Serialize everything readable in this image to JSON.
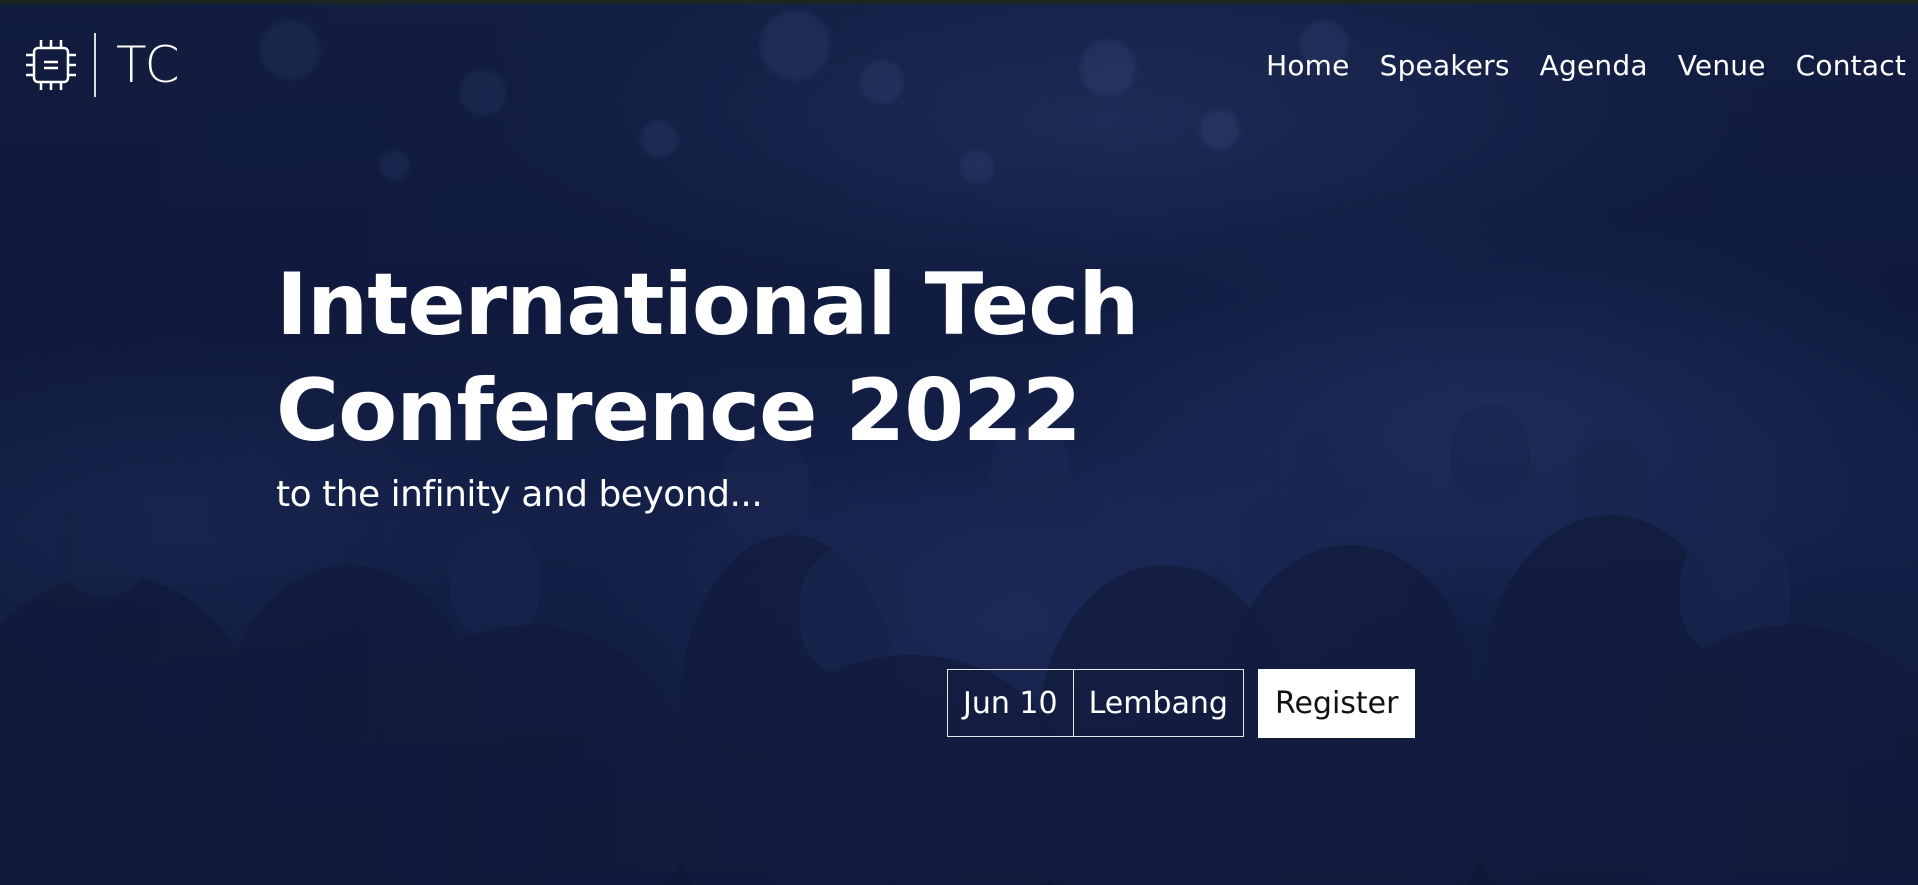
{
  "brand": {
    "logo_icon": "chip-icon",
    "text": "TC"
  },
  "nav": {
    "items": [
      {
        "label": "Home"
      },
      {
        "label": "Speakers"
      },
      {
        "label": "Agenda"
      },
      {
        "label": "Venue"
      },
      {
        "label": "Contact"
      }
    ]
  },
  "hero": {
    "title_line1": "International Tech",
    "title_line2": "Conference 2022",
    "subtitle": "to the infinity and beyond..."
  },
  "event": {
    "date": "Jun 10",
    "location": "Lembang",
    "register_label": "Register"
  },
  "colors": {
    "background": "#13204a",
    "text": "#ffffff",
    "button_bg": "#ffffff",
    "button_text": "#111111"
  }
}
